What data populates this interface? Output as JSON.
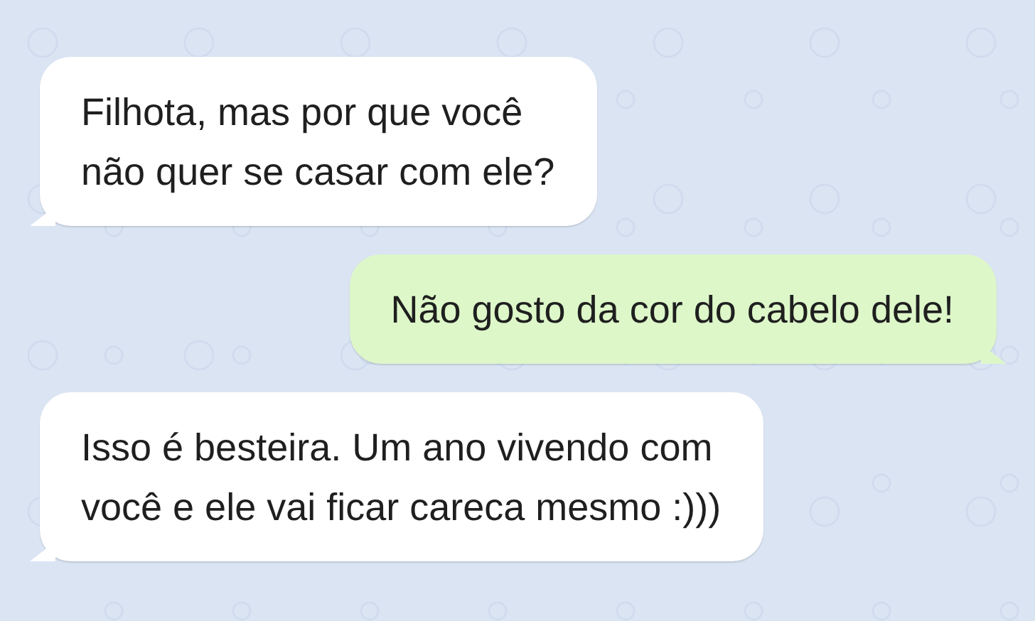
{
  "messages": [
    {
      "kind": "incoming",
      "lines": [
        "Filhota, mas por que você",
        "não quer se casar com ele?"
      ]
    },
    {
      "kind": "outgoing",
      "lines": [
        "Não gosto da cor do cabelo dele!"
      ]
    },
    {
      "kind": "incoming",
      "lines": [
        "Isso é besteira. Um ano vivendo com",
        "você e ele vai ficar careca mesmo :)))"
      ]
    }
  ]
}
